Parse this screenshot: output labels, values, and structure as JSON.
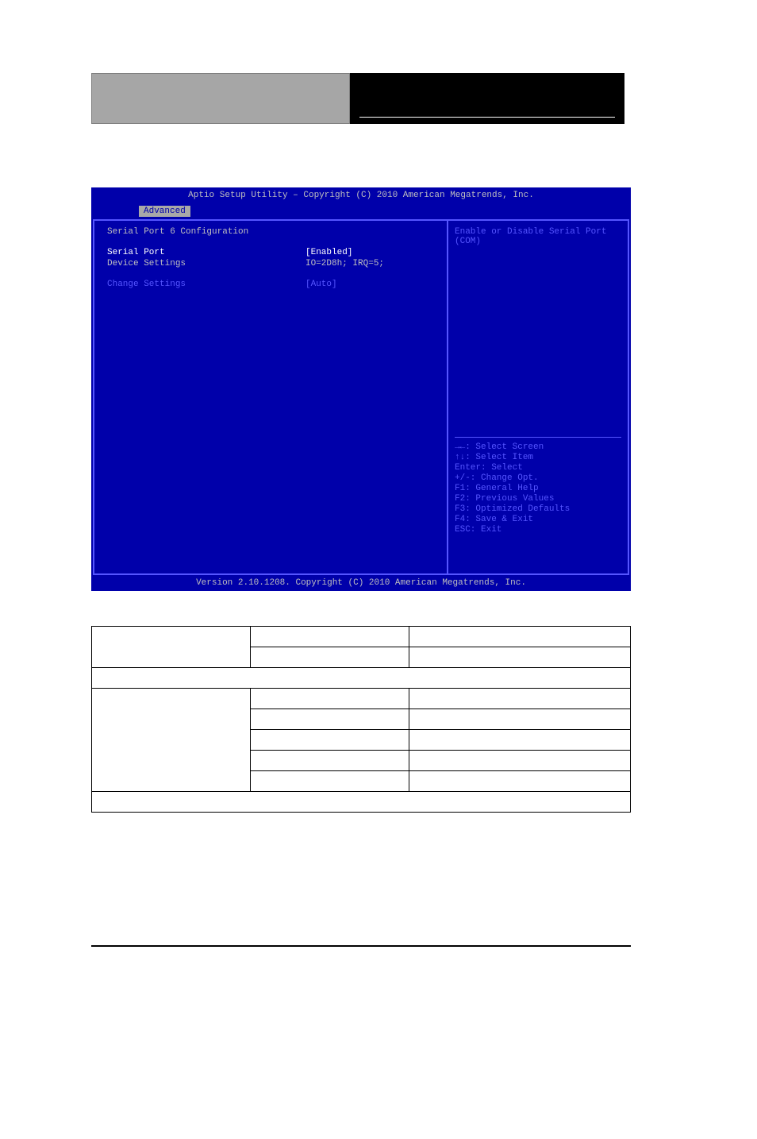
{
  "bios": {
    "title": "Aptio Setup Utility – Copyright (C) 2010 American Megatrends, Inc.",
    "tab": "Advanced",
    "section_title": "Serial Port 6 Configuration",
    "rows": [
      {
        "label": "Serial Port",
        "value": "[Enabled]",
        "highlight": true
      },
      {
        "label": "Device Settings",
        "value": "IO=2D8h; IRQ=5;",
        "highlight": false
      }
    ],
    "setting_rows": [
      {
        "label": "Change Settings",
        "value": "[Auto]"
      }
    ],
    "help_text_line1": "Enable or Disable Serial Port",
    "help_text_line2": "(COM)",
    "nav": {
      "l1": "→←: Select Screen",
      "l2": "↑↓: Select Item",
      "l3": "Enter: Select",
      "l4": "+/-: Change Opt.",
      "l5": "F1: General Help",
      "l6": "F2: Previous Values",
      "l7": "F3: Optimized Defaults",
      "l8": "F4: Save & Exit",
      "l9": "ESC: Exit"
    },
    "footer": "Version 2.10.1208. Copyright (C) 2010 American Megatrends, Inc."
  },
  "table": {
    "r1c1": "",
    "r1c2": "",
    "r1c3": "",
    "r2c2": "",
    "r2c3": "",
    "span1": "",
    "r4c1": "",
    "r4c2": "",
    "r4c3": "",
    "r5c2": "",
    "r5c3": "",
    "r6c2": "",
    "r6c3": "",
    "r7c2": "",
    "r7c3": "",
    "r8c2": "",
    "r8c3": "",
    "span2": ""
  }
}
